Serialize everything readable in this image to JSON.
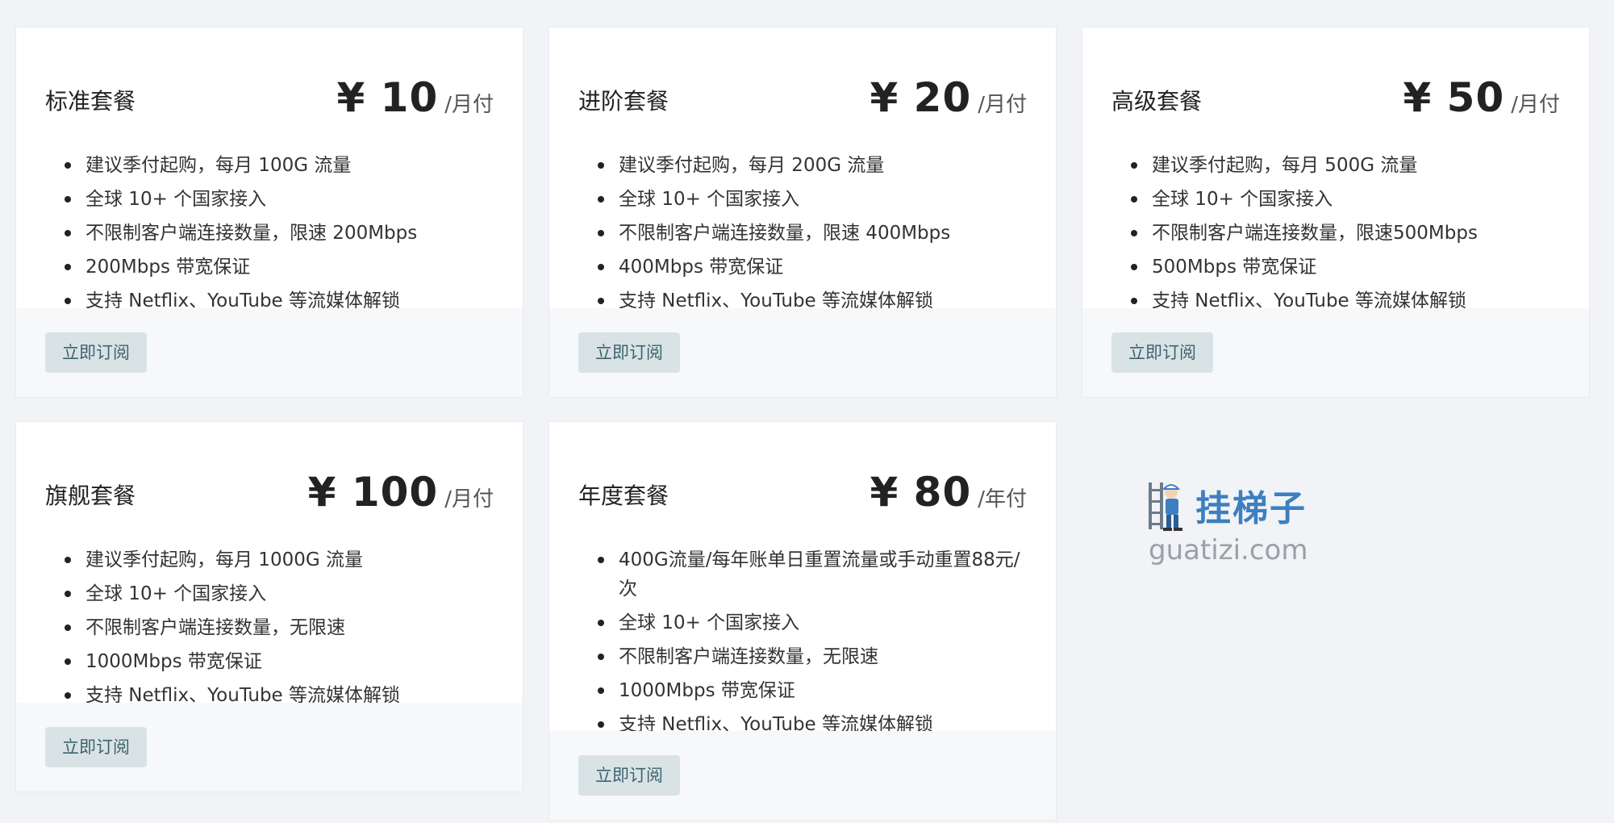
{
  "plans": [
    {
      "name": "标准套餐",
      "price": "¥ 10",
      "unit": "/月付",
      "features": [
        "建议季付起购，每月 100G 流量",
        "全球 10+ 个国家接入",
        "不限制客户端连接数量，限速 200Mbps",
        "200Mbps 带宽保证",
        "支持 Netflix、YouTube 等流媒体解锁"
      ],
      "button": "立即订阅"
    },
    {
      "name": "进阶套餐",
      "price": "¥ 20",
      "unit": "/月付",
      "features": [
        "建议季付起购，每月 200G 流量",
        "全球 10+ 个国家接入",
        "不限制客户端连接数量，限速 400Mbps",
        "400Mbps 带宽保证",
        "支持 Netflix、YouTube 等流媒体解锁"
      ],
      "button": "立即订阅"
    },
    {
      "name": "高级套餐",
      "price": "¥ 50",
      "unit": "/月付",
      "features": [
        "建议季付起购，每月 500G 流量",
        "全球 10+ 个国家接入",
        "不限制客户端连接数量，限速500Mbps",
        "500Mbps 带宽保证",
        "支持 Netflix、YouTube 等流媒体解锁"
      ],
      "button": "立即订阅"
    },
    {
      "name": "旗舰套餐",
      "price": "¥ 100",
      "unit": "/月付",
      "features": [
        "建议季付起购，每月 1000G 流量",
        "全球 10+ 个国家接入",
        "不限制客户端连接数量，无限速",
        "1000Mbps 带宽保证",
        "支持 Netflix、YouTube 等流媒体解锁"
      ],
      "button": "立即订阅"
    },
    {
      "name": "年度套餐",
      "price": "¥ 80",
      "unit": "/年付",
      "features": [
        "400G流量/每年账单日重置流量或手动重置88元/次",
        "全球 10+ 个国家接入",
        "不限制客户端连接数量，无限速",
        "1000Mbps 带宽保证",
        "支持 Netflix、YouTube 等流媒体解锁"
      ],
      "button": "立即订阅"
    }
  ],
  "watermark": {
    "title": "挂梯子",
    "url": "guatizi.com",
    "icon": "ladder-worker-icon"
  },
  "colors": {
    "background": "#f1f3f6",
    "card": "#ffffff",
    "button_bg": "#d9e3e5",
    "button_text": "#3d6470",
    "watermark_title": "#3d7fc1"
  }
}
